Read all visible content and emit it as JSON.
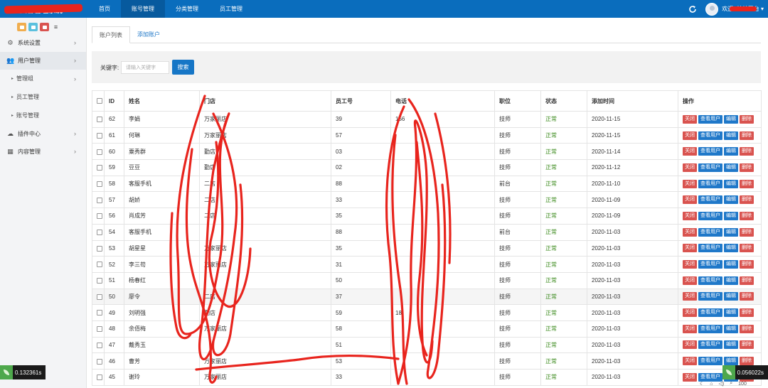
{
  "app": {
    "brand": "某某美容管理系统",
    "welcome": "欢迎, 某某平台"
  },
  "nav": [
    {
      "label": "首页",
      "active": false
    },
    {
      "label": "账号管理",
      "active": true
    },
    {
      "label": "分类管理",
      "active": false
    },
    {
      "label": "员工管理",
      "active": false
    }
  ],
  "sidebar": {
    "items": [
      {
        "label": "系统设置",
        "icon": "gears-icon"
      },
      {
        "label": "用户管理",
        "icon": "users-icon"
      },
      {
        "label": "管理组",
        "icon": "caret-icon"
      },
      {
        "label": "员工管理",
        "icon": "caret-icon"
      },
      {
        "label": "账号管理",
        "icon": "caret-icon"
      },
      {
        "label": "插件中心",
        "icon": "cloud-icon"
      },
      {
        "label": "内容管理",
        "icon": "grid-icon"
      }
    ]
  },
  "tabs": [
    {
      "label": "账户列表"
    },
    {
      "label": "添加账户"
    }
  ],
  "search": {
    "label": "关键字:",
    "placeholder": "请输入关键字",
    "button": "搜索"
  },
  "table": {
    "headers": [
      "",
      "ID",
      "姓名",
      "门店",
      "员工号",
      "电话",
      "职位",
      "状态",
      "添加时间",
      "操作"
    ],
    "ops": [
      "关闭",
      "查看用户",
      "编辑",
      "删除"
    ],
    "rows": [
      {
        "id": "62",
        "name": "李娟",
        "store": "万家丽店",
        "emp": "39",
        "phone": "156",
        "pos": "技师",
        "status": "正常",
        "date": "2020-11-15"
      },
      {
        "id": "61",
        "name": "何琳",
        "store": "万家丽店",
        "emp": "57",
        "phone": "",
        "pos": "技师",
        "status": "正常",
        "date": "2020-11-15"
      },
      {
        "id": "60",
        "name": "粟秀群",
        "store": "勤店",
        "emp": "03",
        "phone": "",
        "pos": "技师",
        "status": "正常",
        "date": "2020-11-14"
      },
      {
        "id": "59",
        "name": "豆豆",
        "store": "勤店",
        "emp": "02",
        "phone": "",
        "pos": "技师",
        "status": "正常",
        "date": "2020-11-12"
      },
      {
        "id": "58",
        "name": "客服手机",
        "store": "二店",
        "emp": "88",
        "phone": "",
        "pos": "前台",
        "status": "正常",
        "date": "2020-11-10"
      },
      {
        "id": "57",
        "name": "胡娇",
        "store": "二店",
        "emp": "33",
        "phone": "",
        "pos": "技师",
        "status": "正常",
        "date": "2020-11-09"
      },
      {
        "id": "56",
        "name": "肖成芳",
        "store": "二店",
        "emp": "35",
        "phone": "",
        "pos": "技师",
        "status": "正常",
        "date": "2020-11-09"
      },
      {
        "id": "54",
        "name": "客服手机",
        "store": "",
        "emp": "88",
        "phone": "",
        "pos": "前台",
        "status": "正常",
        "date": "2020-11-03"
      },
      {
        "id": "53",
        "name": "胡星星",
        "store": "万家丽店",
        "emp": "35",
        "phone": "",
        "pos": "技师",
        "status": "正常",
        "date": "2020-11-03"
      },
      {
        "id": "52",
        "name": "李三苟",
        "store": "万家丽店",
        "emp": "31",
        "phone": "",
        "pos": "技师",
        "status": "正常",
        "date": "2020-11-03"
      },
      {
        "id": "51",
        "name": "杨春红",
        "store": "",
        "emp": "50",
        "phone": "",
        "pos": "技师",
        "status": "正常",
        "date": "2020-11-03"
      },
      {
        "id": "50",
        "name": "廖令",
        "store": "二店",
        "emp": "37",
        "phone": "",
        "pos": "技师",
        "status": "正常",
        "date": "2020-11-03"
      },
      {
        "id": "49",
        "name": "刘明强",
        "store": "勤店",
        "emp": "59",
        "phone": "18",
        "pos": "技师",
        "status": "正常",
        "date": "2020-11-03"
      },
      {
        "id": "48",
        "name": "余佰梅",
        "store": "万家丽店",
        "emp": "58",
        "phone": "",
        "pos": "技师",
        "status": "正常",
        "date": "2020-11-03"
      },
      {
        "id": "47",
        "name": "戴秀玉",
        "store": "",
        "emp": "51",
        "phone": "",
        "pos": "技师",
        "status": "正常",
        "date": "2020-11-03"
      },
      {
        "id": "46",
        "name": "曹芳",
        "store": "万家丽店",
        "emp": "53",
        "phone": "",
        "pos": "技师",
        "status": "正常",
        "date": "2020-11-03"
      },
      {
        "id": "45",
        "name": "谢玲",
        "store": "万家丽店",
        "emp": "33",
        "phone": "",
        "pos": "技师",
        "status": "正常",
        "date": "2020-11-03"
      }
    ]
  },
  "timers": {
    "left": "0.132361s",
    "right": "0.056022s"
  },
  "statusbar": {
    "zoom": "100"
  },
  "colors": {
    "primary": "#0a6dbd",
    "danger": "#d9534f",
    "status_ok": "#3c8b1e",
    "scribble": "#e8241d"
  }
}
